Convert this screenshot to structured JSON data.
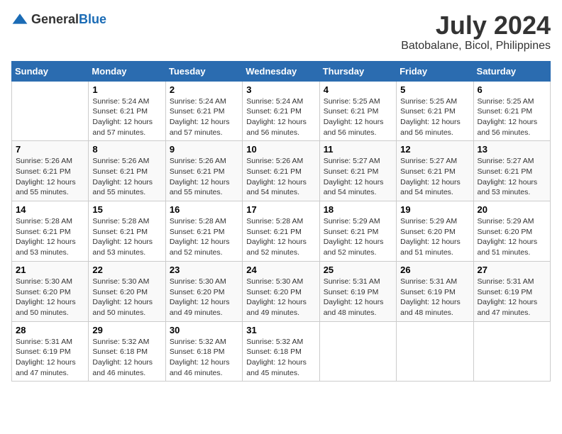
{
  "logo": {
    "general": "General",
    "blue": "Blue"
  },
  "title": {
    "month_year": "July 2024",
    "location": "Batobalane, Bicol, Philippines"
  },
  "days_header": [
    "Sunday",
    "Monday",
    "Tuesday",
    "Wednesday",
    "Thursday",
    "Friday",
    "Saturday"
  ],
  "weeks": [
    [
      {
        "day": "",
        "info": ""
      },
      {
        "day": "1",
        "info": "Sunrise: 5:24 AM\nSunset: 6:21 PM\nDaylight: 12 hours\nand 57 minutes."
      },
      {
        "day": "2",
        "info": "Sunrise: 5:24 AM\nSunset: 6:21 PM\nDaylight: 12 hours\nand 57 minutes."
      },
      {
        "day": "3",
        "info": "Sunrise: 5:24 AM\nSunset: 6:21 PM\nDaylight: 12 hours\nand 56 minutes."
      },
      {
        "day": "4",
        "info": "Sunrise: 5:25 AM\nSunset: 6:21 PM\nDaylight: 12 hours\nand 56 minutes."
      },
      {
        "day": "5",
        "info": "Sunrise: 5:25 AM\nSunset: 6:21 PM\nDaylight: 12 hours\nand 56 minutes."
      },
      {
        "day": "6",
        "info": "Sunrise: 5:25 AM\nSunset: 6:21 PM\nDaylight: 12 hours\nand 56 minutes."
      }
    ],
    [
      {
        "day": "7",
        "info": "Sunrise: 5:26 AM\nSunset: 6:21 PM\nDaylight: 12 hours\nand 55 minutes."
      },
      {
        "day": "8",
        "info": "Sunrise: 5:26 AM\nSunset: 6:21 PM\nDaylight: 12 hours\nand 55 minutes."
      },
      {
        "day": "9",
        "info": "Sunrise: 5:26 AM\nSunset: 6:21 PM\nDaylight: 12 hours\nand 55 minutes."
      },
      {
        "day": "10",
        "info": "Sunrise: 5:26 AM\nSunset: 6:21 PM\nDaylight: 12 hours\nand 54 minutes."
      },
      {
        "day": "11",
        "info": "Sunrise: 5:27 AM\nSunset: 6:21 PM\nDaylight: 12 hours\nand 54 minutes."
      },
      {
        "day": "12",
        "info": "Sunrise: 5:27 AM\nSunset: 6:21 PM\nDaylight: 12 hours\nand 54 minutes."
      },
      {
        "day": "13",
        "info": "Sunrise: 5:27 AM\nSunset: 6:21 PM\nDaylight: 12 hours\nand 53 minutes."
      }
    ],
    [
      {
        "day": "14",
        "info": "Sunrise: 5:28 AM\nSunset: 6:21 PM\nDaylight: 12 hours\nand 53 minutes."
      },
      {
        "day": "15",
        "info": "Sunrise: 5:28 AM\nSunset: 6:21 PM\nDaylight: 12 hours\nand 53 minutes."
      },
      {
        "day": "16",
        "info": "Sunrise: 5:28 AM\nSunset: 6:21 PM\nDaylight: 12 hours\nand 52 minutes."
      },
      {
        "day": "17",
        "info": "Sunrise: 5:28 AM\nSunset: 6:21 PM\nDaylight: 12 hours\nand 52 minutes."
      },
      {
        "day": "18",
        "info": "Sunrise: 5:29 AM\nSunset: 6:21 PM\nDaylight: 12 hours\nand 52 minutes."
      },
      {
        "day": "19",
        "info": "Sunrise: 5:29 AM\nSunset: 6:20 PM\nDaylight: 12 hours\nand 51 minutes."
      },
      {
        "day": "20",
        "info": "Sunrise: 5:29 AM\nSunset: 6:20 PM\nDaylight: 12 hours\nand 51 minutes."
      }
    ],
    [
      {
        "day": "21",
        "info": "Sunrise: 5:30 AM\nSunset: 6:20 PM\nDaylight: 12 hours\nand 50 minutes."
      },
      {
        "day": "22",
        "info": "Sunrise: 5:30 AM\nSunset: 6:20 PM\nDaylight: 12 hours\nand 50 minutes."
      },
      {
        "day": "23",
        "info": "Sunrise: 5:30 AM\nSunset: 6:20 PM\nDaylight: 12 hours\nand 49 minutes."
      },
      {
        "day": "24",
        "info": "Sunrise: 5:30 AM\nSunset: 6:20 PM\nDaylight: 12 hours\nand 49 minutes."
      },
      {
        "day": "25",
        "info": "Sunrise: 5:31 AM\nSunset: 6:19 PM\nDaylight: 12 hours\nand 48 minutes."
      },
      {
        "day": "26",
        "info": "Sunrise: 5:31 AM\nSunset: 6:19 PM\nDaylight: 12 hours\nand 48 minutes."
      },
      {
        "day": "27",
        "info": "Sunrise: 5:31 AM\nSunset: 6:19 PM\nDaylight: 12 hours\nand 47 minutes."
      }
    ],
    [
      {
        "day": "28",
        "info": "Sunrise: 5:31 AM\nSunset: 6:19 PM\nDaylight: 12 hours\nand 47 minutes."
      },
      {
        "day": "29",
        "info": "Sunrise: 5:32 AM\nSunset: 6:18 PM\nDaylight: 12 hours\nand 46 minutes."
      },
      {
        "day": "30",
        "info": "Sunrise: 5:32 AM\nSunset: 6:18 PM\nDaylight: 12 hours\nand 46 minutes."
      },
      {
        "day": "31",
        "info": "Sunrise: 5:32 AM\nSunset: 6:18 PM\nDaylight: 12 hours\nand 45 minutes."
      },
      {
        "day": "",
        "info": ""
      },
      {
        "day": "",
        "info": ""
      },
      {
        "day": "",
        "info": ""
      }
    ]
  ]
}
